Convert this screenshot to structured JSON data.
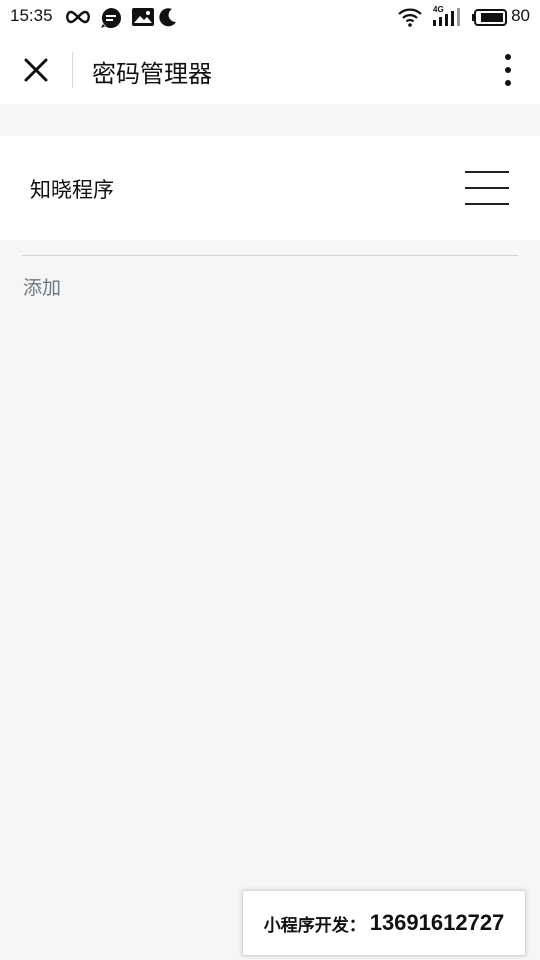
{
  "status_bar": {
    "time": "15:35",
    "network": "4G",
    "battery": "80",
    "icons": [
      "infinity-icon",
      "message-icon",
      "gallery-icon",
      "moon-icon",
      "wifi-icon",
      "signal-icon",
      "battery-icon"
    ]
  },
  "title_bar": {
    "title": "密码管理器",
    "close_icon": "close-icon",
    "more_icon": "more-vertical-icon"
  },
  "header": {
    "brand": "知晓程序",
    "menu_icon": "hamburger-menu-icon"
  },
  "main": {
    "add_label": "添加"
  },
  "promo": {
    "label": "小程序开发：",
    "phone": "13691612727"
  },
  "colors": {
    "background": "#f6f6f6",
    "surface": "#ffffff",
    "link": "#6b7785",
    "divider": "#d4d4d4"
  }
}
